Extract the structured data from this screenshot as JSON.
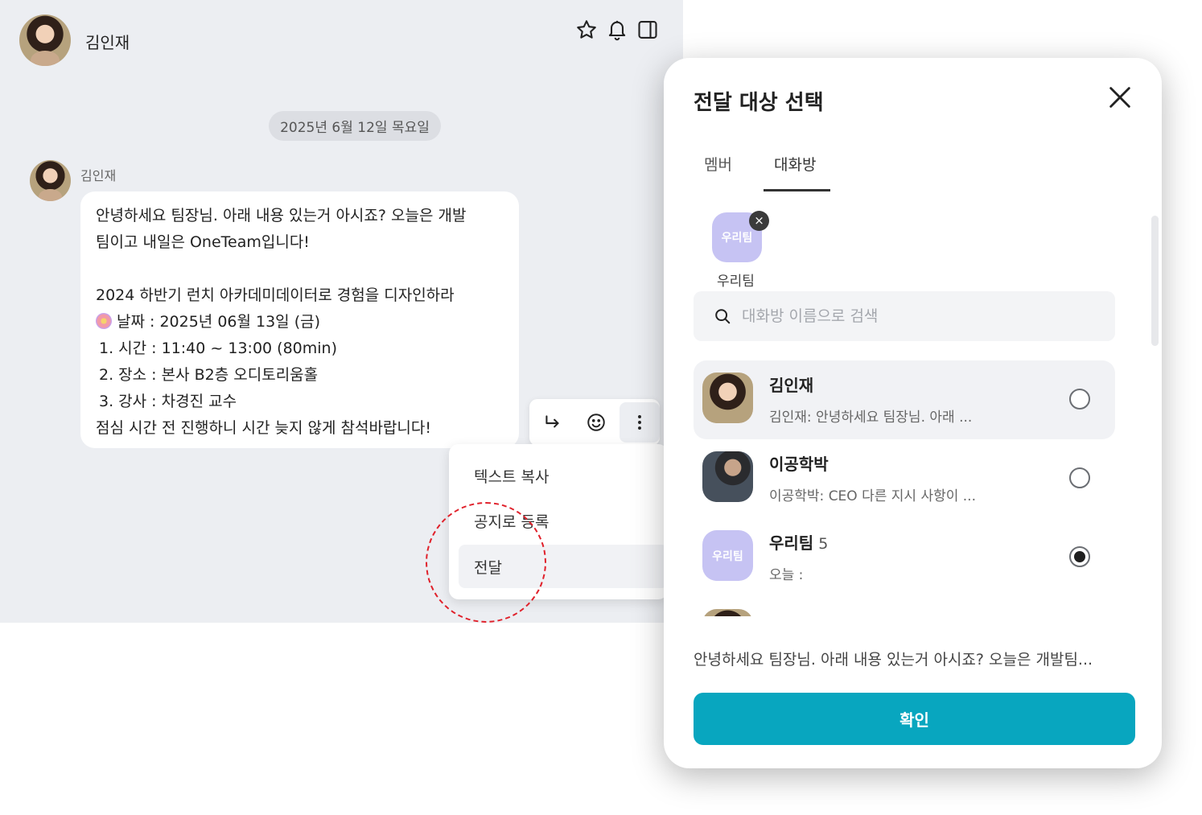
{
  "chat": {
    "contact_name": "김인재",
    "date_divider": "2025년 6월 12일 목요일",
    "message": {
      "sender": "김인재",
      "lines": [
        "안녕하세요 팀장님. 아래 내용 있는거 아시죠? 오늘은 개발",
        "팀이고 내일은 OneTeam입니다!",
        "",
        "2024 하반기 런치 아카데미데이터로 경험을 디자인하라",
        "날짜 : 2025년 06월 13일 (금)",
        "1. 시간 : 11:40 ~ 13:00 (80min)",
        "2. 장소 : 본사 B2층 오디토리움홀",
        "3. 강사 : 차경진 교수",
        "점심 시간 전 진행하니 시간 늦지 않게 참석바랍니다!"
      ]
    },
    "header_icons": [
      "star-icon",
      "bell-icon",
      "sidebar-panel-icon"
    ],
    "message_actions": [
      "reply-arrow-icon",
      "emoji-icon",
      "more-vertical-icon"
    ],
    "context_menu": {
      "copy_text": "텍스트 복사",
      "register_notice": "공지로 등록",
      "forward": "전달"
    }
  },
  "modal": {
    "title": "전달 대상 선택",
    "tabs": {
      "member": "멤버",
      "chatroom": "대화방"
    },
    "active_tab": "대화방",
    "selected_chip": {
      "avatar_text": "우리팀",
      "label": "우리팀"
    },
    "search_placeholder": "대화방 이름으로 검색",
    "rooms": [
      {
        "name": "김인재",
        "count": "",
        "preview": "김인재: 안녕하세요 팀장님. 아래 ...",
        "selected": false
      },
      {
        "name": "이공학박",
        "count": "",
        "preview": "이공학박: CEO 다른 지시 사항이 ...",
        "selected": false
      },
      {
        "name": "우리팀",
        "count": "5",
        "avatar_text": "우리팀",
        "preview": "오늘 :",
        "selected": true
      }
    ],
    "forward_preview": "안녕하세요 팀장님. 아래 내용 있는거 아시죠? 오늘은 개발팀...",
    "confirm_label": "확인"
  },
  "colors": {
    "chat_background": "#eceef2",
    "confirm_button": "#08a6bf",
    "group_avatar": "#c6c3f3",
    "annotation_circle": "#e0212b"
  }
}
